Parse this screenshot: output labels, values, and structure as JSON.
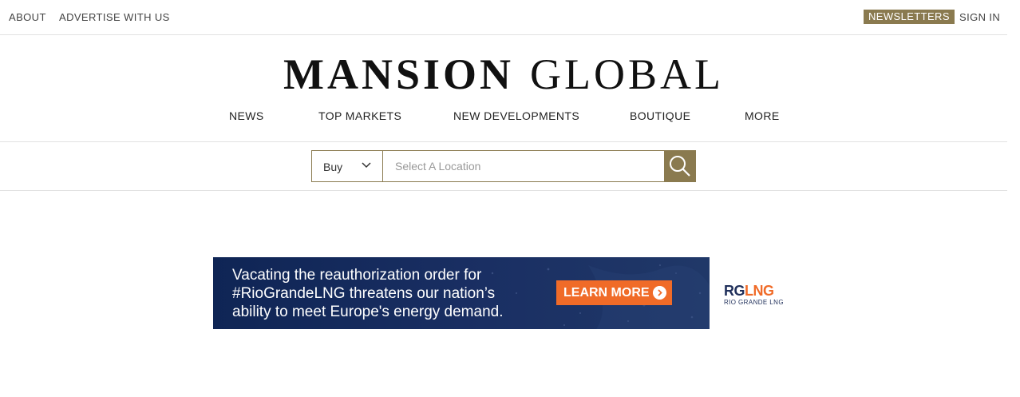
{
  "topbar": {
    "left_links": [
      "ABOUT",
      "ADVERTISE WITH US"
    ],
    "newsletters": "NEWSLETTERS",
    "sign_in": "SIGN IN"
  },
  "logo": {
    "word1": "MANSION",
    "word2": "GLOBAL"
  },
  "nav": [
    "NEWS",
    "TOP MARKETS",
    "NEW DEVELOPMENTS",
    "BOUTIQUE",
    "MORE"
  ],
  "search": {
    "select_value": "Buy",
    "placeholder": "Select A Location",
    "icon": "search-icon"
  },
  "ad": {
    "text": "Vacating the reauthorization order for #RioGrandeLNG threatens our nation's ability to meet Europe's energy demand.",
    "line1": "Vacating the reauthorization order for",
    "line2": "#RioGrandeLNG threatens our nation’s",
    "line3": "ability to meet Europe's energy demand.",
    "cta": "LEARN MORE",
    "brand_rg": "RG",
    "brand_lng": "LNG",
    "brand_sub": "RIO GRANDE LNG"
  },
  "colors": {
    "accent": "#8a7a4f",
    "ad_bg": "#0f2555",
    "ad_cta": "#f06b28"
  }
}
